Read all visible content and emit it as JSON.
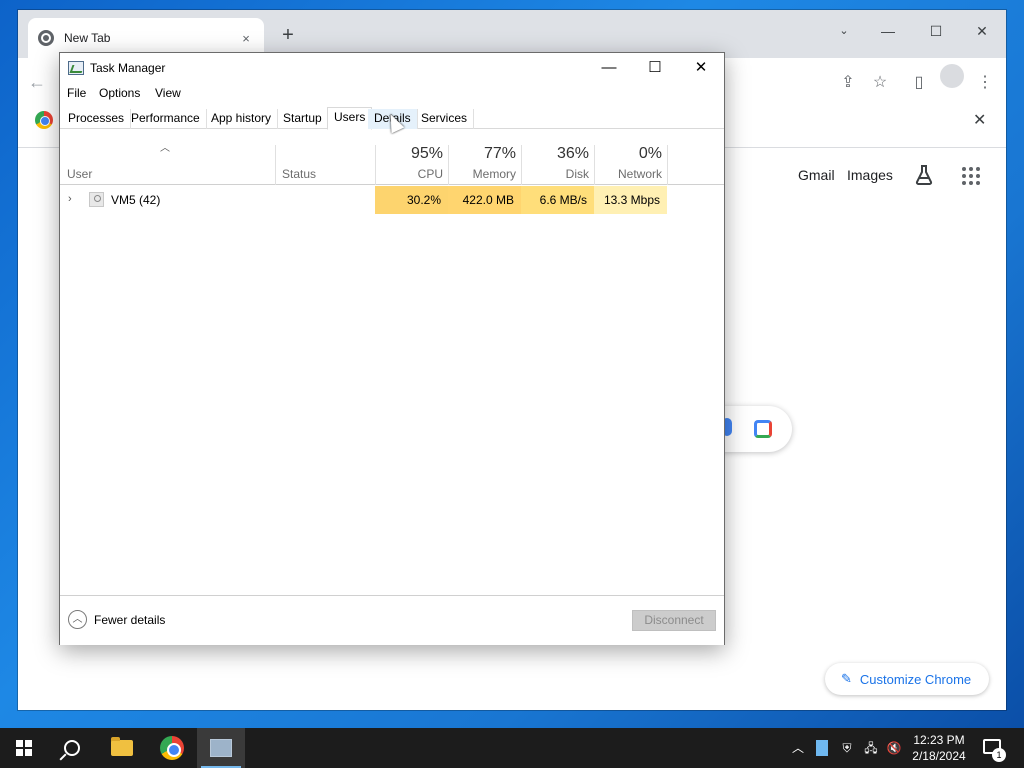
{
  "chrome": {
    "tab_title": "New Tab",
    "tab_close": "×",
    "new_tab": "+",
    "links": {
      "gmail": "Gmail",
      "images": "Images"
    },
    "customize_label": "Customize Chrome",
    "infobar_close": "✕"
  },
  "task_manager": {
    "title": "Task Manager",
    "menu": [
      "File",
      "Options",
      "View"
    ],
    "tabs": [
      "Processes",
      "Performance",
      "App history",
      "Startup",
      "Users",
      "Details",
      "Services"
    ],
    "active_tab": "Users",
    "columns": {
      "user": "User",
      "status": "Status",
      "cpu": {
        "pct": "95%",
        "label": "CPU"
      },
      "memory": {
        "pct": "77%",
        "label": "Memory"
      },
      "disk": {
        "pct": "36%",
        "label": "Disk"
      },
      "network": {
        "pct": "0%",
        "label": "Network"
      }
    },
    "rows": [
      {
        "name": "VM5 (42)",
        "status": "",
        "cpu": "30.2%",
        "memory": "422.0 MB",
        "disk": "6.6 MB/s",
        "network": "13.3 Mbps"
      }
    ],
    "footer": {
      "fewer_details": "Fewer details",
      "disconnect": "Disconnect"
    }
  },
  "taskbar": {
    "clock_time": "12:23 PM",
    "clock_date": "2/18/2024",
    "notification_count": "1"
  },
  "colors": {
    "cpu_heat": "#fdd46e",
    "memory_heat": "#ffd56f",
    "disk_heat": "#ffde7a",
    "network_heat": "#fff0b3",
    "accent": "#1a73e8"
  }
}
